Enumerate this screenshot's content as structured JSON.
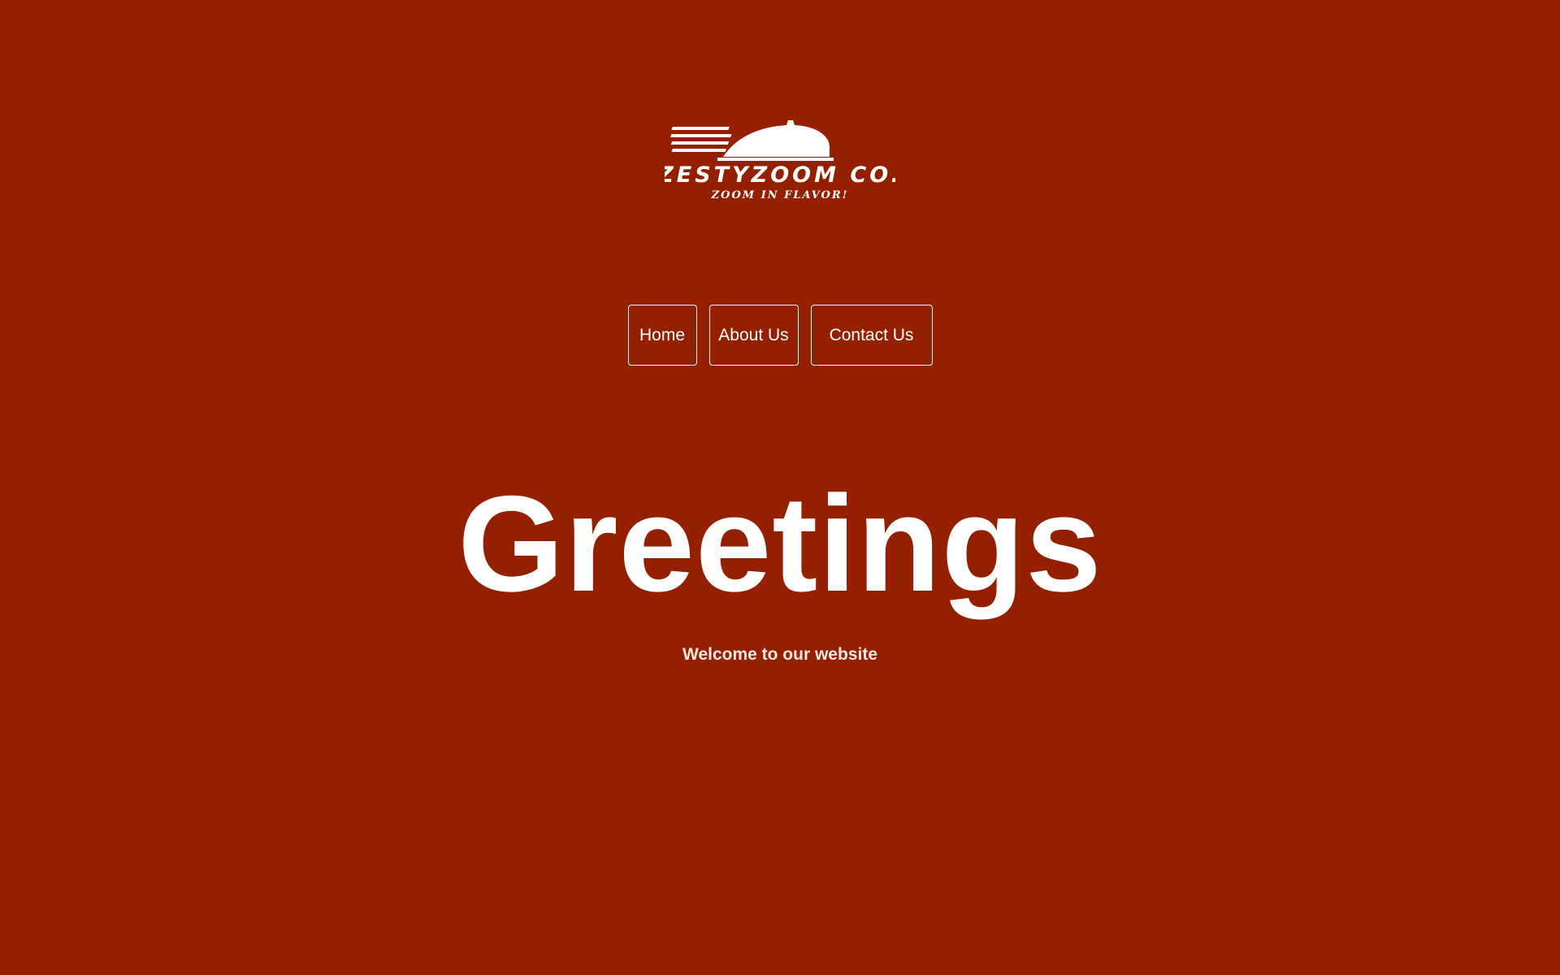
{
  "logo": {
    "brand_name": "ZESTYZOOM CO.",
    "tagline": "ZOOM IN FLAVOR!",
    "icon": "speeding-dome-logo-icon"
  },
  "nav": {
    "items": [
      {
        "label": "Home"
      },
      {
        "label": "About Us"
      },
      {
        "label": "Contact Us"
      }
    ]
  },
  "hero": {
    "title": "Greetings",
    "subtitle": "Welcome to our website"
  },
  "colors": {
    "background": "#952000",
    "text": "#ffffff",
    "subtitle": "#f2e6e2"
  }
}
